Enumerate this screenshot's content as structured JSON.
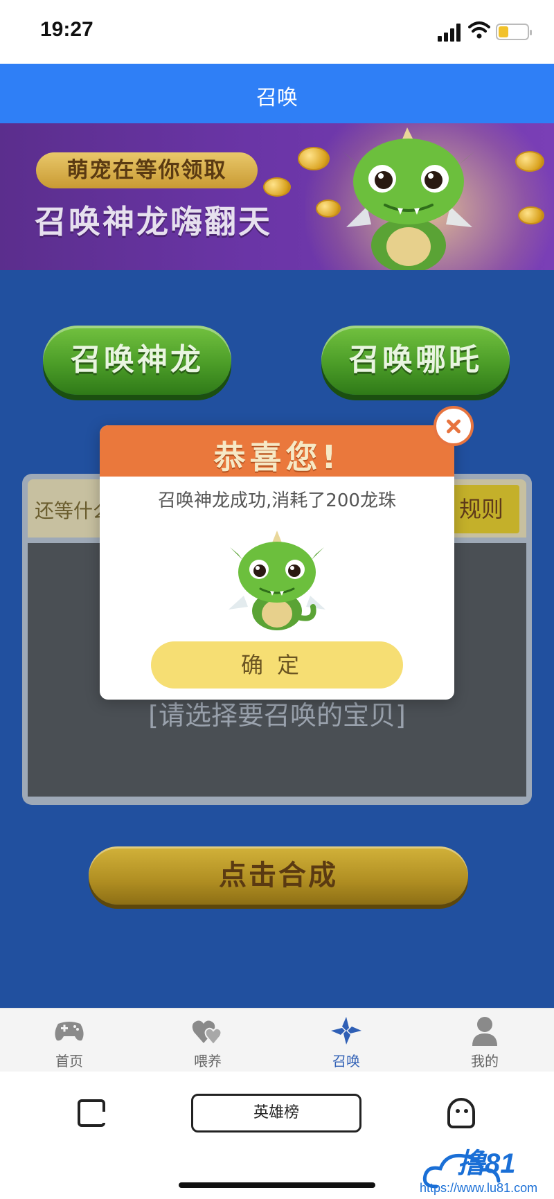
{
  "status_bar": {
    "time": "19:27"
  },
  "header": {
    "title": "召唤"
  },
  "banner": {
    "pill_text": "萌宠在等你领取",
    "headline": "召唤神龙嗨翻天"
  },
  "summon_buttons": [
    {
      "label": "召唤神龙"
    },
    {
      "label": "召唤哪吒"
    }
  ],
  "panel": {
    "strip_text": "还等什么",
    "rules_label": "规则",
    "hint": "[请选择要召唤的宝贝]"
  },
  "merge_button": {
    "label": "点击合成"
  },
  "modal": {
    "title": "恭喜您!",
    "message": "召唤神龙成功,消耗了200龙珠",
    "confirm_label": "确定"
  },
  "tabs": [
    {
      "label": "首页",
      "icon": "gamepad-icon",
      "active": false
    },
    {
      "label": "喂养",
      "icon": "hearts-icon",
      "active": false
    },
    {
      "label": "召唤",
      "icon": "pinwheel-icon",
      "active": true
    },
    {
      "label": "我的",
      "icon": "user-icon",
      "active": false
    }
  ],
  "browser": {
    "center_label": "英雄榜"
  },
  "watermark": {
    "logo": "撸81",
    "url": "https://www.lu81.com"
  },
  "colors": {
    "header_blue": "#2f7ff6",
    "main_blue": "#21509f",
    "green_button": "#4c9d28",
    "modal_orange": "#ea783c",
    "confirm_yellow": "#f6de73",
    "active_tab": "#2f5fb5"
  }
}
